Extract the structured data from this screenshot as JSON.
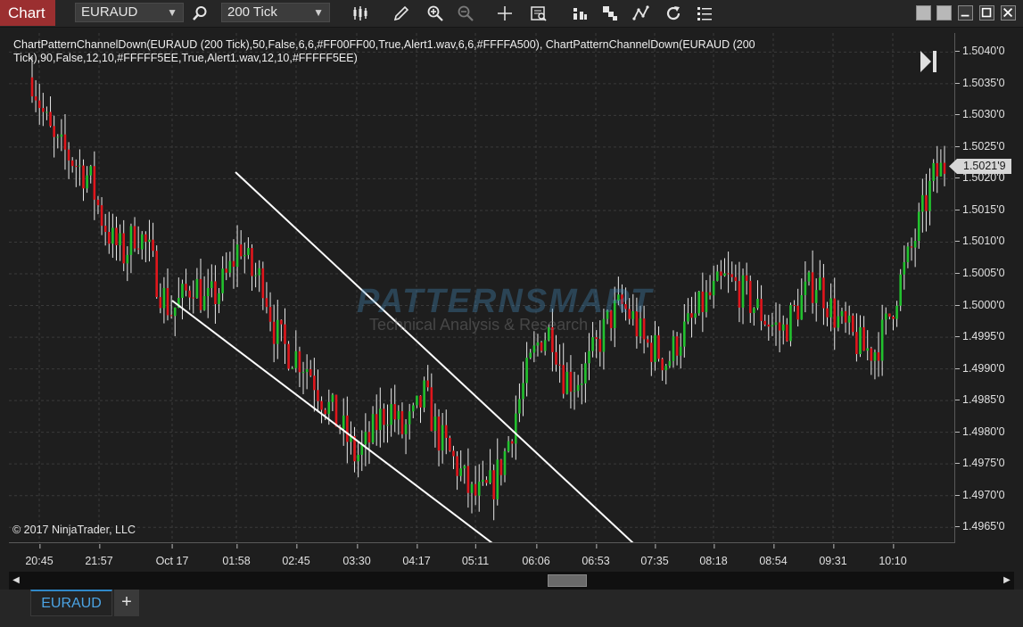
{
  "toolbar": {
    "chart_label": "Chart",
    "instrument": "EURAUD",
    "interval": "200 Tick",
    "icons": [
      "search-icon",
      "bar-type-icon",
      "draw-pencil-icon",
      "zoom-in-icon",
      "zoom-out-icon",
      "crosshair-icon",
      "data-box-icon",
      "indicators-icon",
      "strategies-icon",
      "drawing-tools-icon",
      "reload-icon",
      "properties-icon"
    ],
    "window_buttons": [
      "restore-icon",
      "minimize-icon",
      "maximize-icon",
      "close-icon"
    ]
  },
  "chart": {
    "indicator_label": "ChartPatternChannelDown(EURAUD (200 Tick),50,False,6,6,#FF00FF00,True,Alert1.wav,6,6,#FFFFA500), ChartPatternChannelDown(EURAUD (200 Tick),90,False,12,10,#FFFFF5EE,True,Alert1.wav,12,10,#FFFFF5EE)",
    "copyright": "© 2017 NinjaTrader, LLC",
    "watermark_title": "PATTERNSMART",
    "watermark_subtitle": "Technical Analysis & Research",
    "current_price": "1.5021'9",
    "y_ticks": [
      "1.5040'0",
      "1.5035'0",
      "1.5030'0",
      "1.5025'0",
      "1.5020'0",
      "1.5015'0",
      "1.5010'0",
      "1.5005'0",
      "1.5000'0",
      "1.4995'0",
      "1.4990'0",
      "1.4985'0",
      "1.4980'0",
      "1.4975'0",
      "1.4970'0",
      "1.4965'0"
    ],
    "x_ticks": [
      "20:45",
      "21:57",
      "Oct 17",
      "01:58",
      "02:45",
      "03:30",
      "04:17",
      "05:11",
      "06:06",
      "06:53",
      "07:35",
      "08:18",
      "08:54",
      "09:31",
      "10:10"
    ],
    "colors": {
      "up": "#22c12e",
      "down": "#e0161c",
      "wick": "#e8e8e8",
      "channel": "#ffffff"
    }
  },
  "chart_data": {
    "type": "candlestick",
    "y_range": [
      1.49625,
      1.5043
    ],
    "close_path": [
      1.5036,
      1.503,
      1.5025,
      1.5024,
      1.5022,
      1.502,
      1.5014,
      1.501,
      1.5008,
      1.5012,
      1.5009,
      1.5003,
      1.4999,
      1.5001,
      1.5004,
      1.5,
      1.5002,
      1.5005,
      1.501,
      1.5005,
      1.5004,
      1.4996,
      1.4993,
      1.4992,
      1.499,
      1.4986,
      1.4983,
      1.498,
      1.4976,
      1.4978,
      1.4982,
      1.4984,
      1.498,
      1.4982,
      1.4986,
      1.498,
      1.4977,
      1.4974,
      1.497,
      1.497,
      1.4972,
      1.4977,
      1.4984,
      1.499,
      1.4995,
      1.4996,
      1.4989,
      1.4988,
      1.499,
      1.4994,
      1.4998,
      1.5,
      1.4998,
      1.4994,
      1.4993,
      1.4991,
      1.4995,
      1.4997,
      1.5,
      1.5002,
      1.5004,
      1.5003,
      1.5001,
      1.4999,
      1.4997,
      1.4996,
      1.4999,
      1.5002,
      1.5004,
      1.5,
      1.4997,
      1.4995,
      1.4993,
      1.4993,
      1.4997,
      1.5003,
      1.5008,
      1.5014,
      1.502,
      1.5022
    ],
    "channels": [
      {
        "name": "upper",
        "from": [
          "00:55",
          1.5021
        ],
        "to": [
          "07:30",
          1.4964
        ]
      },
      {
        "name": "lower",
        "from": [
          "23:55",
          1.4999
        ],
        "to": [
          "05:25",
          1.4964
        ]
      }
    ]
  }
}
